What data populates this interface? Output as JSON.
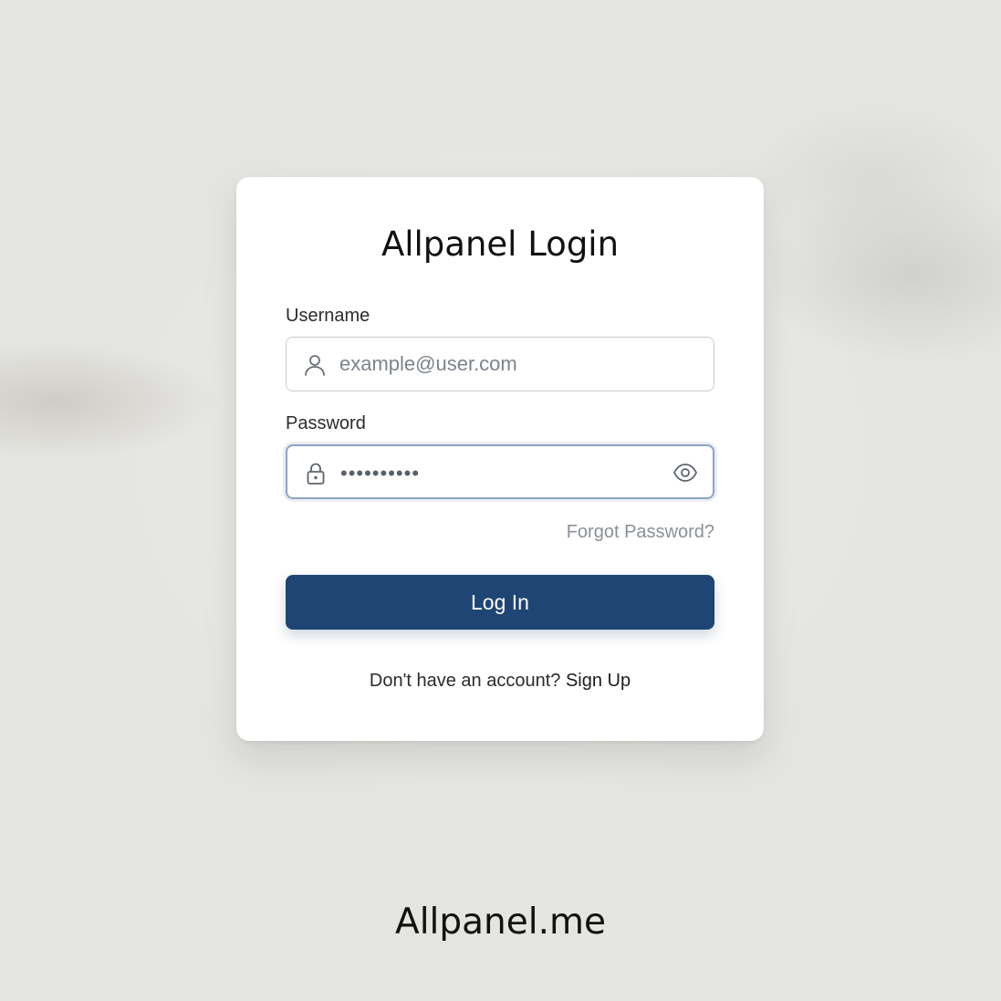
{
  "card": {
    "title": "Allpanel Login",
    "username": {
      "label": "Username",
      "placeholder": "example@user.com",
      "icon": "user-icon"
    },
    "password": {
      "label": "Password",
      "masked_value": "••••••••••",
      "icon": "lock-icon",
      "toggle_icon": "eye-icon"
    },
    "forgot_password": "Forgot Password?",
    "login_button": "Log In",
    "signup_prompt": "Don't have an account?",
    "signup_link": "Sign Up"
  },
  "footer": {
    "site": "Allpanel.me"
  },
  "colors": {
    "button_bg": "#1e4574",
    "background": "#e4e4e0",
    "focus_border": "#8da3c1"
  }
}
